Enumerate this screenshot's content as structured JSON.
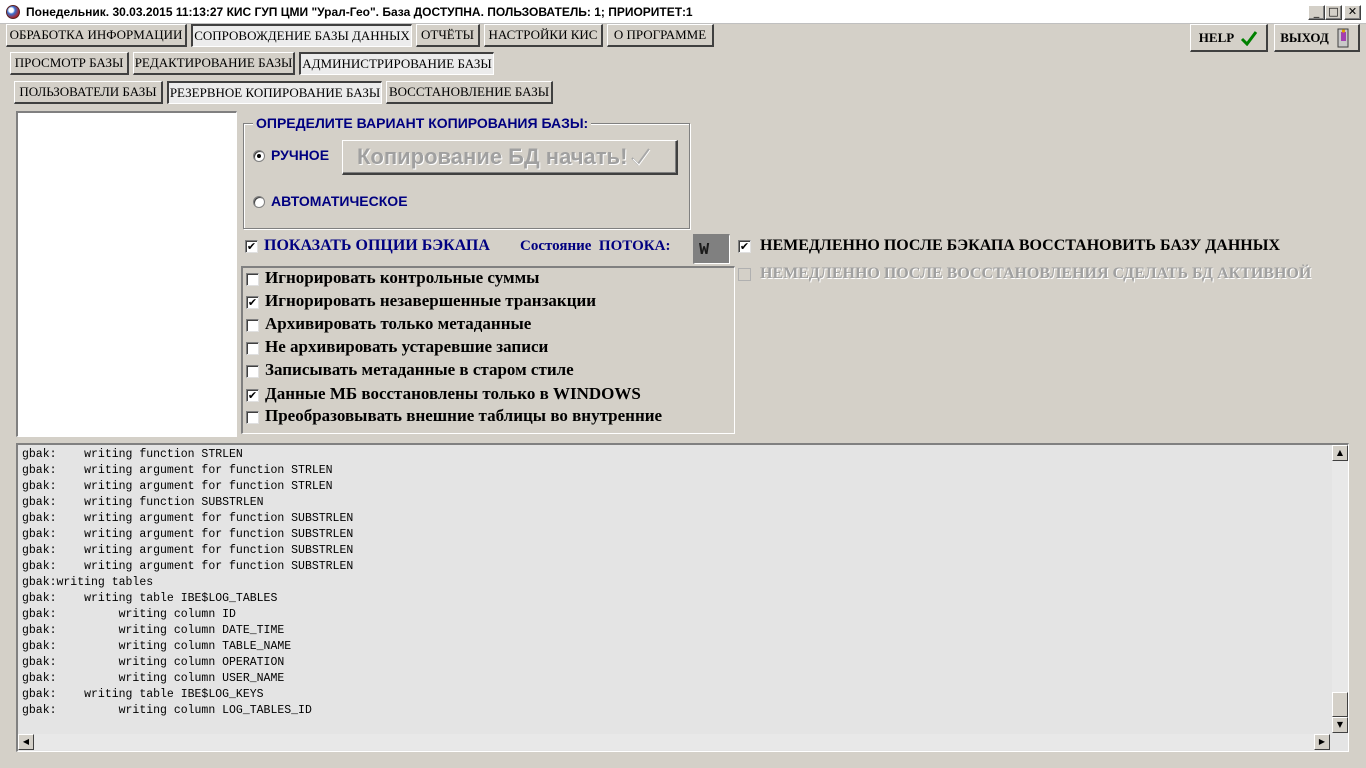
{
  "window": {
    "title": "Понедельник. 30.03.2015 11:13:27 КИС ГУП ЦМИ \"Урал-Гео\". База ДОСТУПНА. ПОЛЬЗОВАТЕЛЬ: 1; ПРИОРИТЕТ:1",
    "controls": {
      "minimize": "_",
      "maximize": "□",
      "close": "✕"
    }
  },
  "main_tabs": [
    {
      "label": "ОБРАБОТКА ИНФОРМАЦИИ",
      "active": false
    },
    {
      "label": "СОПРОВОЖДЕНИЕ БАЗЫ ДАННЫХ",
      "active": true
    },
    {
      "label": "ОТЧЁТЫ",
      "active": false
    },
    {
      "label": "НАСТРОЙКИ КИС",
      "active": false
    },
    {
      "label": "О ПРОГРАММЕ",
      "active": false
    }
  ],
  "top_buttons": {
    "help": "HELP",
    "exit": "ВЫХОД"
  },
  "sub_tabs": [
    {
      "label": "ПРОСМОТР БАЗЫ",
      "active": false
    },
    {
      "label": "РЕДАКТИРОВАНИЕ БАЗЫ",
      "active": false
    },
    {
      "label": "АДМИНИСТРИРОВАНИЕ БАЗЫ",
      "active": true
    }
  ],
  "admin_tabs": [
    {
      "label": "ПОЛЬЗОВАТЕЛИ БАЗЫ",
      "active": false
    },
    {
      "label": "РЕЗЕРВНОЕ КОПИРОВАНИЕ БАЗЫ",
      "active": true
    },
    {
      "label": "ВОССТАНОВЛЕНИЕ БАЗЫ",
      "active": false
    }
  ],
  "copy_mode": {
    "title": "ОПРЕДЕЛИТЕ ВАРИАНТ КОПИРОВАНИЯ БАЗЫ:",
    "manual": {
      "label": "РУЧНОЕ",
      "selected": true
    },
    "auto": {
      "label": "АВТОМАТИЧЕСКОЕ",
      "selected": false
    },
    "start_button": "Копирование БД начать!"
  },
  "show_options": {
    "label": "ПОКАЗАТЬ ОПЦИИ БЭКАПА",
    "checked": true
  },
  "thread_state": {
    "label": "Состояние  ПОТОКА:",
    "value": "W"
  },
  "after_backup": {
    "restore": {
      "label": "НЕМЕДЛЕННО ПОСЛЕ БЭКАПА ВОССТАНОВИТЬ БАЗУ ДАННЫХ",
      "checked": true,
      "enabled": true
    },
    "activate": {
      "label": "НЕМЕДЛЕННО ПОСЛЕ ВОССТАНОВЛЕНИЯ СДЕЛАТЬ БД АКТИВНОЙ",
      "checked": false,
      "enabled": false
    }
  },
  "options": [
    {
      "label": "Игнорировать контрольные суммы",
      "checked": false
    },
    {
      "label": "Игнорировать незавершенные транзакции",
      "checked": true
    },
    {
      "label": "Архивировать только метаданные",
      "checked": false
    },
    {
      "label": "Не архивировать устаревшие записи",
      "checked": false
    },
    {
      "label": "Записывать метаданные в старом стиле",
      "checked": false
    },
    {
      "label": "Данные МБ восстановлены только в WINDOWS",
      "checked": true
    },
    {
      "label": "Преобразовывать внешние таблицы во внутренние",
      "checked": false
    }
  ],
  "log_lines": [
    "gbak:    writing function STRLEN",
    "gbak:    writing argument for function STRLEN",
    "gbak:    writing argument for function STRLEN",
    "gbak:    writing function SUBSTRLEN",
    "gbak:    writing argument for function SUBSTRLEN",
    "gbak:    writing argument for function SUBSTRLEN",
    "gbak:    writing argument for function SUBSTRLEN",
    "gbak:    writing argument for function SUBSTRLEN",
    "gbak:writing tables",
    "gbak:    writing table IBE$LOG_TABLES",
    "gbak:         writing column ID",
    "gbak:         writing column DATE_TIME",
    "gbak:         writing column TABLE_NAME",
    "gbak:         writing column OPERATION",
    "gbak:         writing column USER_NAME",
    "gbak:    writing table IBE$LOG_KEYS",
    "gbak:         writing column LOG_TABLES_ID"
  ],
  "colors": {
    "face": "#d4d0c8",
    "label_blue": "#000080",
    "disabled_text": "#a0a0a0"
  },
  "icons": {
    "help": "checkmark-icon",
    "exit": "door-exit-icon"
  }
}
